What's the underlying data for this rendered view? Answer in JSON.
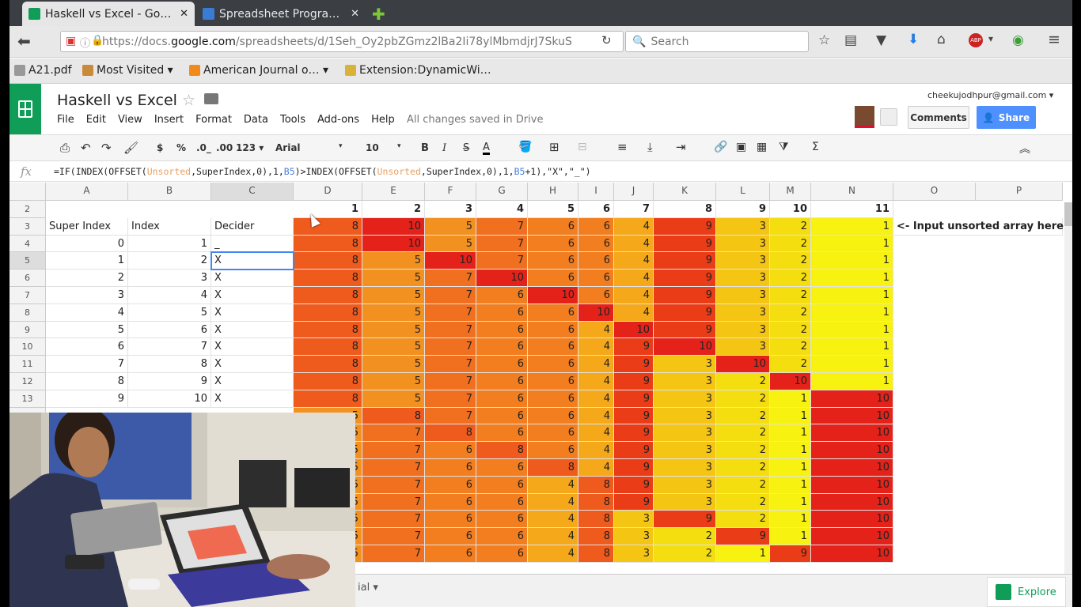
{
  "browser": {
    "tabs": [
      {
        "title": "Haskell vs Excel - Go…",
        "close": "✕",
        "favicon_color": "#0f9d58"
      },
      {
        "title": "Spreadsheet Progra…",
        "close": "✕",
        "favicon_color": "#3a7bd5"
      }
    ],
    "new_tab": "✚",
    "url_prefix": "https://docs.",
    "url_domain": "google.com",
    "url_rest": "/spreadsheets/d/1Seh_Oy2pbZGmz2lBa2Ii78ylMbmdjrJ7SkuS",
    "search_placeholder": "Search",
    "bookmarks": [
      {
        "label": "A21.pdf",
        "icon": "pdf-icon"
      },
      {
        "label": "Most Visited ▾",
        "icon": "folder-icon"
      },
      {
        "label": "American Journal o… ▾",
        "icon": "rss-icon"
      },
      {
        "label": "Extension:DynamicWi…",
        "icon": "extension-icon"
      }
    ]
  },
  "app": {
    "doc_title": "Haskell vs Excel",
    "menu": [
      "File",
      "Edit",
      "View",
      "Insert",
      "Format",
      "Data",
      "Tools",
      "Add-ons",
      "Help"
    ],
    "save_status": "All changes saved in Drive",
    "email": "cheekujodhpur@gmail.com ▾",
    "comments_label": "Comments",
    "share_label": "Share",
    "toolbar": {
      "currency": "$",
      "percent": "%",
      "dec_less": ".0_",
      "dec_more": ".00",
      "more_formats": "123 ▾",
      "font": "Arial",
      "font_size": "10",
      "bold": "B",
      "italic": "I",
      "strike": "S",
      "text_color": "A",
      "sum": "Σ"
    },
    "fx_label": "fx",
    "formula": {
      "p1": "=IF(INDEX(OFFSET(",
      "r1": "Unsorted",
      "p2": ",SuperIndex,0),1,",
      "f1": "B5",
      "p3": ")>INDEX(OFFSET(",
      "r2": "Unsorted",
      "p4": ",SuperIndex,0),1,",
      "f2": "B5",
      "p5": "+1),\"X\",\"_\")"
    },
    "explore_label": "Explore",
    "sheet_tab_fragment": "ial ▾"
  },
  "grid": {
    "columns": [
      "A",
      "B",
      "C",
      "D",
      "E",
      "F",
      "G",
      "H",
      "I",
      "J",
      "K",
      "L",
      "M",
      "N",
      "O",
      "P"
    ],
    "row_numbers": [
      "2",
      "3",
      "4",
      "5",
      "6",
      "7",
      "8",
      "9",
      "10",
      "11",
      "12",
      "13"
    ],
    "header_row": [
      "1",
      "2",
      "3",
      "4",
      "5",
      "6",
      "7",
      "8",
      "9",
      "10",
      "11"
    ],
    "labels": {
      "a": "Super Index",
      "b": "Index",
      "c": "Decider"
    },
    "note": "<- Input unsorted array here",
    "left_rows": [
      [
        "0",
        "1",
        "_"
      ],
      [
        "1",
        "2",
        "X"
      ],
      [
        "2",
        "3",
        "X"
      ],
      [
        "3",
        "4",
        "X"
      ],
      [
        "4",
        "5",
        "X"
      ],
      [
        "5",
        "6",
        "X"
      ],
      [
        "6",
        "7",
        "X"
      ],
      [
        "7",
        "8",
        "X"
      ],
      [
        "8",
        "9",
        "X"
      ],
      [
        "9",
        "10",
        "X"
      ]
    ],
    "heat_rows": [
      [
        8,
        10,
        5,
        7,
        6,
        6,
        4,
        9,
        3,
        2,
        1
      ],
      [
        8,
        10,
        5,
        7,
        6,
        6,
        4,
        9,
        3,
        2,
        1
      ],
      [
        8,
        5,
        10,
        7,
        6,
        6,
        4,
        9,
        3,
        2,
        1
      ],
      [
        8,
        5,
        7,
        10,
        6,
        6,
        4,
        9,
        3,
        2,
        1
      ],
      [
        8,
        5,
        7,
        6,
        10,
        6,
        4,
        9,
        3,
        2,
        1
      ],
      [
        8,
        5,
        7,
        6,
        6,
        10,
        4,
        9,
        3,
        2,
        1
      ],
      [
        8,
        5,
        7,
        6,
        6,
        4,
        10,
        9,
        3,
        2,
        1
      ],
      [
        8,
        5,
        7,
        6,
        6,
        4,
        9,
        10,
        3,
        2,
        1
      ],
      [
        8,
        5,
        7,
        6,
        6,
        4,
        9,
        3,
        10,
        2,
        1
      ],
      [
        8,
        5,
        7,
        6,
        6,
        4,
        9,
        3,
        2,
        10,
        1
      ],
      [
        8,
        5,
        7,
        6,
        6,
        4,
        9,
        3,
        2,
        1,
        10
      ],
      [
        5,
        8,
        7,
        6,
        6,
        4,
        9,
        3,
        2,
        1,
        10
      ],
      [
        5,
        7,
        8,
        6,
        6,
        4,
        9,
        3,
        2,
        1,
        10
      ],
      [
        5,
        7,
        6,
        8,
        6,
        4,
        9,
        3,
        2,
        1,
        10
      ],
      [
        5,
        7,
        6,
        6,
        8,
        4,
        9,
        3,
        2,
        1,
        10
      ],
      [
        5,
        7,
        6,
        6,
        4,
        8,
        9,
        3,
        2,
        1,
        10
      ],
      [
        5,
        7,
        6,
        6,
        4,
        8,
        9,
        3,
        2,
        1,
        10
      ],
      [
        5,
        7,
        6,
        6,
        4,
        8,
        3,
        9,
        2,
        1,
        10
      ],
      [
        5,
        7,
        6,
        6,
        4,
        8,
        3,
        2,
        9,
        1,
        10
      ],
      [
        5,
        7,
        6,
        6,
        4,
        8,
        3,
        2,
        1,
        9,
        10
      ]
    ],
    "heat_colors": {
      "1": "#f7f20f",
      "2": "#f5de10",
      "3": "#f5c514",
      "4": "#f5a81a",
      "5": "#f39120",
      "6": "#f27e1f",
      "7": "#f07020",
      "8": "#ef5a1d",
      "9": "#eb3c18",
      "10": "#e5221a"
    }
  }
}
